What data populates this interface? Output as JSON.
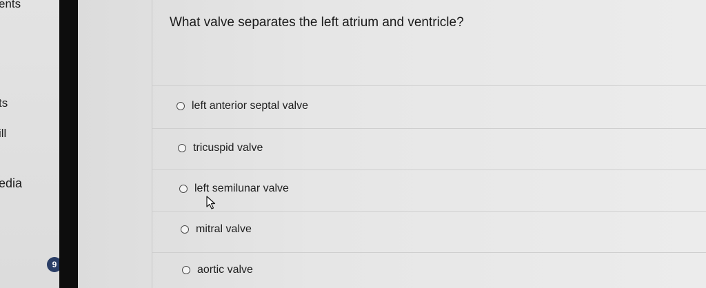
{
  "sidebar": {
    "items": [
      {
        "label": "ents"
      },
      {
        "label": "ts"
      },
      {
        "label": "ill"
      },
      {
        "label": "edia"
      }
    ],
    "badge": "9"
  },
  "quiz": {
    "question": "What valve separates the left atrium and ventricle?",
    "options": [
      {
        "label": "left anterior septal valve"
      },
      {
        "label": "tricuspid valve"
      },
      {
        "label": "left semilunar valve"
      },
      {
        "label": "mitral valve"
      },
      {
        "label": "aortic valve"
      }
    ]
  },
  "colors": {
    "divider": "#0d0d0d",
    "badge": "#2a3e66",
    "background": "#e6e6e6"
  },
  "icons": {
    "cursor": "mouse-pointer-icon",
    "radio": "radio-button-icon"
  }
}
